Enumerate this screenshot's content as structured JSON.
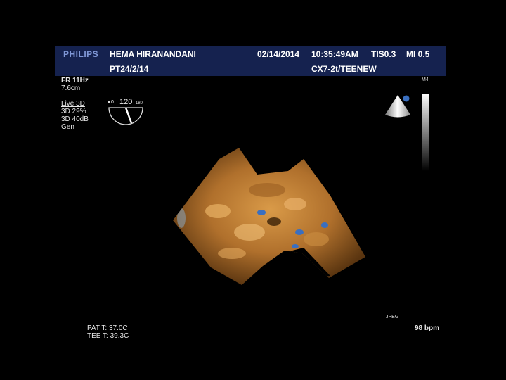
{
  "header": {
    "brand": "PHILIPS",
    "patient_name": "HEMA HIRANANDANI",
    "date": "02/14/2014",
    "time": "10:35:49AM",
    "tis": "TIS0.3",
    "mi": "MI 0.5",
    "patient_id": "PT24/2/14",
    "probe": "CX7-2t/TEENEW"
  },
  "params": {
    "frame_rate": "FR 11Hz",
    "depth": "7.6cm",
    "mode": "Live 3D",
    "gain": "3D 29%",
    "compress": "3D 40dB",
    "preset": "Gen"
  },
  "angle_indicator": {
    "value": "120",
    "left": "0",
    "right": "180"
  },
  "scale_label": "M4",
  "format_label": "JPEG",
  "heart_rate": "98 bpm",
  "temps": {
    "pat": "PAT T: 37.0C",
    "tee": "TEE T: 39.3C"
  },
  "colors": {
    "header_bg": "#15224f",
    "brand": "#7f97d6",
    "tissue": "#c8893a",
    "accent": "#3a6fc0"
  }
}
